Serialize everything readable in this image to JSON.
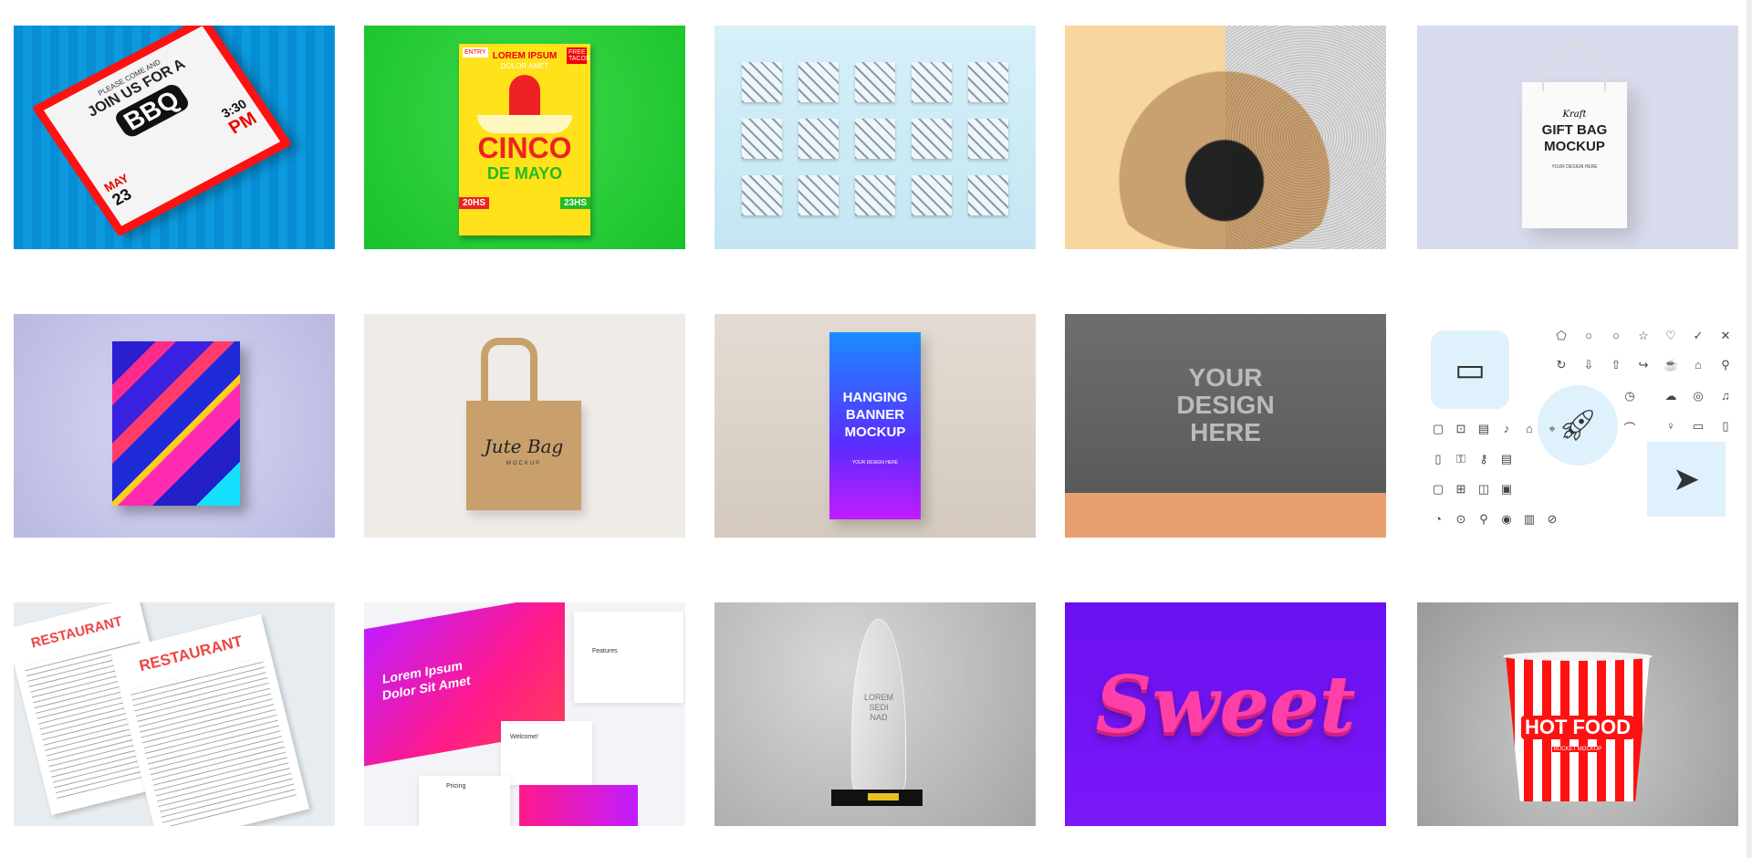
{
  "tiles": [
    {
      "name": "bbq-flyer",
      "lines": [
        "PLEASE COME AND",
        "JOIN US FOR A",
        "BBQ",
        "MAY",
        "23",
        "3:30",
        "PM"
      ]
    },
    {
      "name": "cinco-de-mayo-poster",
      "lines": [
        "LOREM IPSUM",
        "DOLOR AMET",
        "CINCO",
        "DE MAYO",
        "20HS",
        "23HS",
        "FREE TACOS",
        "ENTRY"
      ]
    },
    {
      "name": "seamless-patterns"
    },
    {
      "name": "pug-halftone"
    },
    {
      "name": "kraft-gift-bag",
      "lines": [
        "Kraft",
        "GIFT BAG",
        "MOCKUP",
        "YOUR DESIGN HERE"
      ]
    },
    {
      "name": "abstract-canvas"
    },
    {
      "name": "jute-bag",
      "lines": [
        "Jute Bag",
        "MOCKUP"
      ]
    },
    {
      "name": "hanging-banner",
      "lines": [
        "HANGING",
        "BANNER",
        "MOCKUP",
        "YOUR DESIGN HERE"
      ]
    },
    {
      "name": "wall-mockup",
      "lines": [
        "YOUR",
        "DESIGN",
        "HERE"
      ]
    },
    {
      "name": "icon-set"
    },
    {
      "name": "restaurant-menu",
      "lines": [
        "RESTAURANT",
        "RESTAURANT"
      ]
    },
    {
      "name": "website-ui-kit",
      "lines": [
        "Lorem Ipsum",
        "Dolor Sit Amet",
        "Welcome!",
        "Pricing",
        "Features"
      ]
    },
    {
      "name": "glass-trophy",
      "lines": [
        "LOREM",
        "SEDI",
        "NAD"
      ]
    },
    {
      "name": "sweet-3d-text",
      "lines": [
        "Sweet"
      ]
    },
    {
      "name": "hot-food-bucket",
      "lines": [
        "HOT FOOD",
        "BUCKET MOCKUP"
      ]
    }
  ],
  "colors": {
    "bbq_bg": "#2cd4f5",
    "cinco_bg": "#18c22a",
    "sweet_bg": "#6a10f0",
    "bucket_red": "#f11"
  }
}
